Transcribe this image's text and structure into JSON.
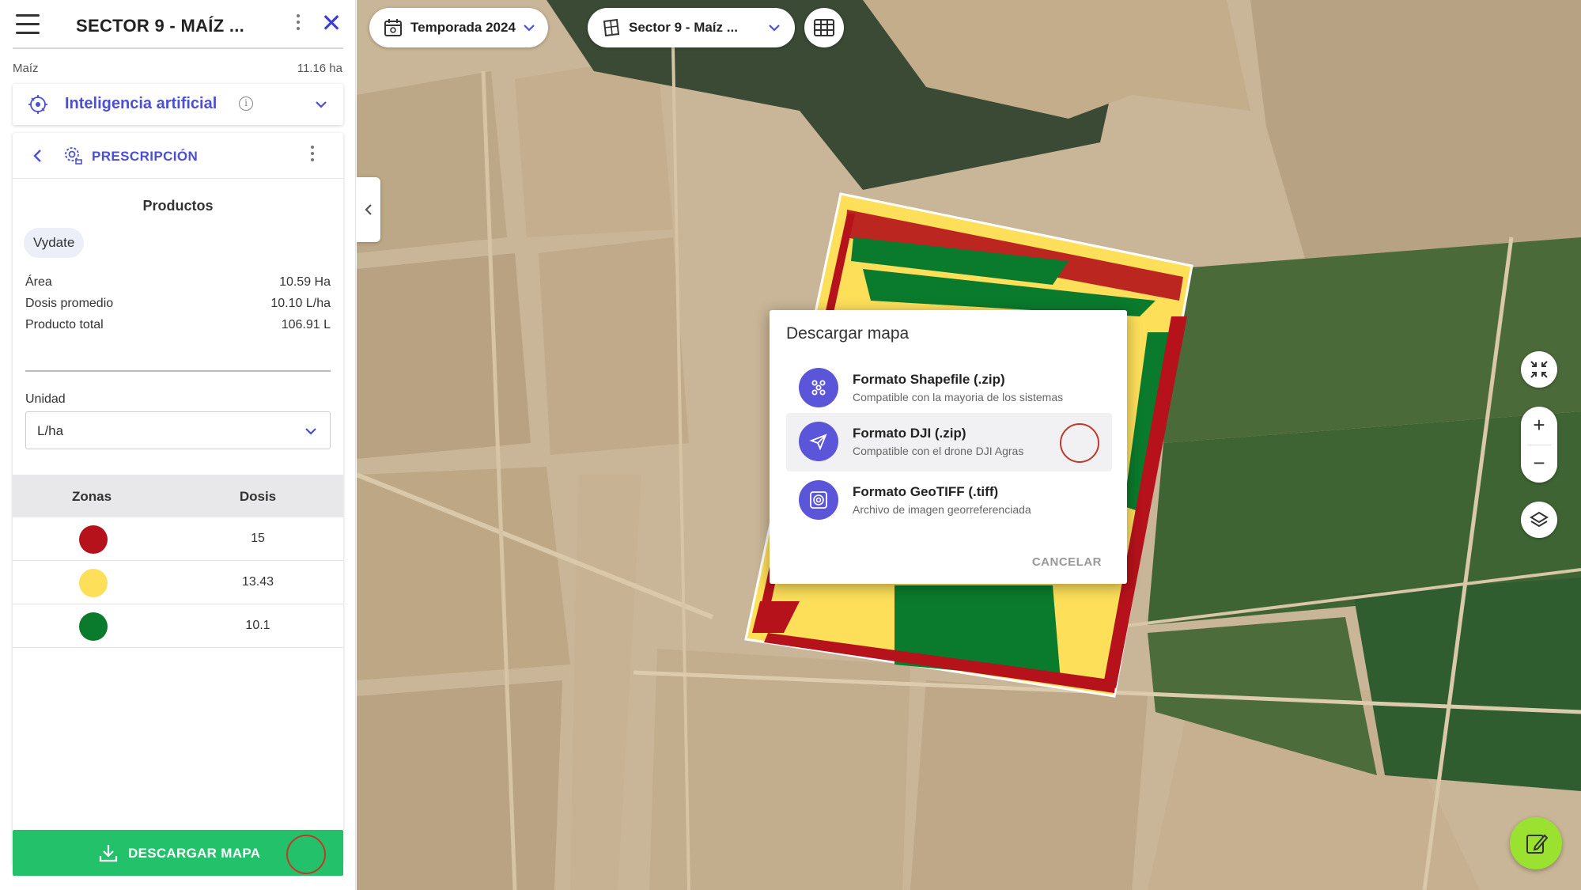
{
  "sidebar": {
    "title": "SECTOR 9 - MAÍZ ...",
    "crop": "Maíz",
    "area": "11.16 ha",
    "ai_section": {
      "label": "Inteligencia artificial",
      "info": "i"
    },
    "prescription": {
      "label": "PRESCRIPCIÓN",
      "products_title": "Productos",
      "product_chip": "Vydate",
      "stats": [
        {
          "label": "Área",
          "value": "10.59 Ha"
        },
        {
          "label": "Dosis promedio",
          "value": "10.10 L/ha"
        },
        {
          "label": "Producto total",
          "value": "106.91 L"
        }
      ],
      "unit_label": "Unidad",
      "unit_value": "L/ha",
      "table": {
        "headers": [
          "Zonas",
          "Dosis"
        ],
        "rows": [
          {
            "color": "#b5121b",
            "dose": "15"
          },
          {
            "color": "#fddf5a",
            "dose": "13.43"
          },
          {
            "color": "#0a7a2c",
            "dose": "10.1"
          }
        ]
      }
    },
    "download_label": "DESCARGAR MAPA"
  },
  "toolbar": {
    "season_label": "Temporada 2024",
    "field_label": "Sector 9 - Maíz ..."
  },
  "zoom": {
    "in": "+",
    "out": "−"
  },
  "dialog": {
    "title": "Descargar mapa",
    "options": [
      {
        "title": "Formato Shapefile (.zip)",
        "subtitle": "Compatible con la mayoria de los sistemas",
        "icon": "shapefile-icon"
      },
      {
        "title": "Formato DJI (.zip)",
        "subtitle": "Compatible con el drone DJI Agras",
        "icon": "drone-icon"
      },
      {
        "title": "Formato GeoTIFF (.tiff)",
        "subtitle": "Archivo de imagen georreferenciada",
        "icon": "geotiff-icon"
      }
    ],
    "cancel_label": "CANCELAR"
  },
  "colors": {
    "accent": "#4b4fd6",
    "primary_button": "#23c26a",
    "fab": "#9be12f",
    "zone_red": "#b5121b",
    "zone_yellow": "#fddf5a",
    "zone_green": "#0a7a2c"
  }
}
